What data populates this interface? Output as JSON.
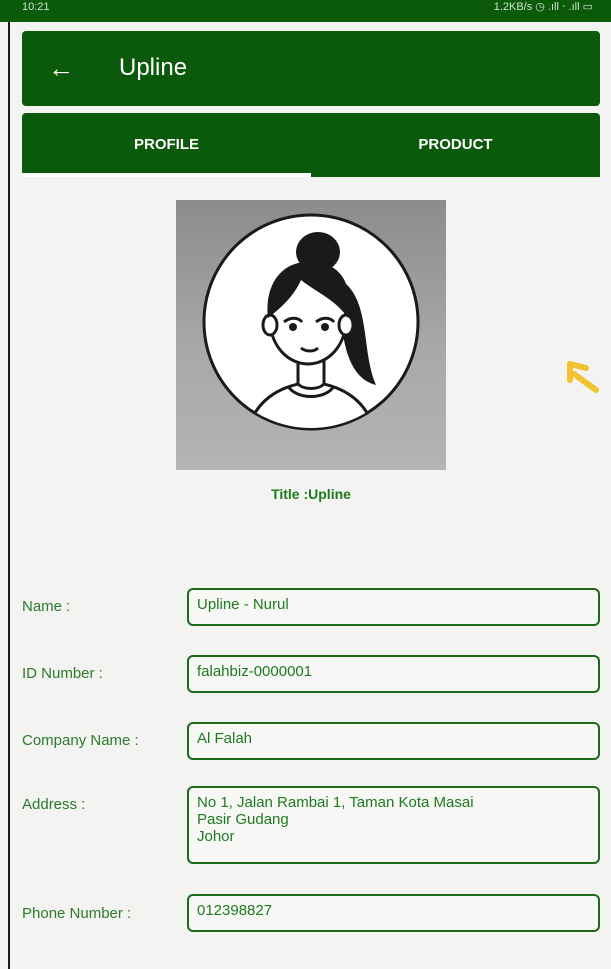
{
  "status_bar": {
    "time": "10:21",
    "right_text": "1.2KB/s ◷ .ıll ‧ .ıll ▭"
  },
  "app_bar": {
    "back_icon": "arrow-left-icon",
    "title": "Upline"
  },
  "tabs": [
    {
      "label": "PROFILE",
      "selected": true
    },
    {
      "label": "PRODUCT",
      "selected": false
    }
  ],
  "profile": {
    "avatar_icon": "woman-avatar-icon",
    "title_line": "Title :Upline"
  },
  "fields": {
    "name": {
      "label": "Name :",
      "value": "Upline - Nurul"
    },
    "id_number": {
      "label": "ID Number :",
      "value": "falahbiz-0000001"
    },
    "company_name": {
      "label": "Company Name :",
      "value": "Al Falah"
    },
    "address": {
      "label": "Address :",
      "value": "No 1, Jalan Rambai 1, Taman Kota Masai\nPasir Gudang\nJohor"
    },
    "phone_number": {
      "label": "Phone Number :",
      "value": "012398827"
    }
  },
  "colors": {
    "primary": "#0b5a0b",
    "accent_text": "#1b7a1b",
    "arrow_decoration": "#f2c230"
  }
}
